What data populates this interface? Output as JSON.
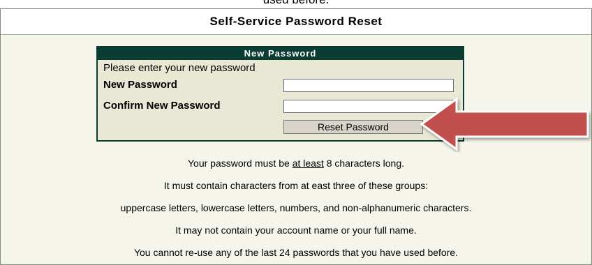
{
  "clipped_top_text": "used before.",
  "panel": {
    "title": "Self-Service Password Reset"
  },
  "new_password_box": {
    "title": "New Password",
    "instruction": "Please enter your new password",
    "new_password_label": "New Password",
    "new_password_value": "",
    "confirm_label": "Confirm New Password",
    "confirm_value": "",
    "reset_button_label": "Reset Password"
  },
  "rules": {
    "line1_prefix": "Your password must be ",
    "line1_emphasis": "at least",
    "line1_suffix": " 8 characters long.",
    "line2": "It must contain characters from at east three of these groups:",
    "line3": "uppercase letters, lowercase letters, numbers, and non-alphanumeric characters.",
    "line4": "It may not contain your account name or your full name.",
    "line5": "You cannot re-use any of the last 24 passwords that you have used before."
  },
  "annotation": {
    "icon": "red-arrow-icon",
    "color": "#c0504d"
  }
}
